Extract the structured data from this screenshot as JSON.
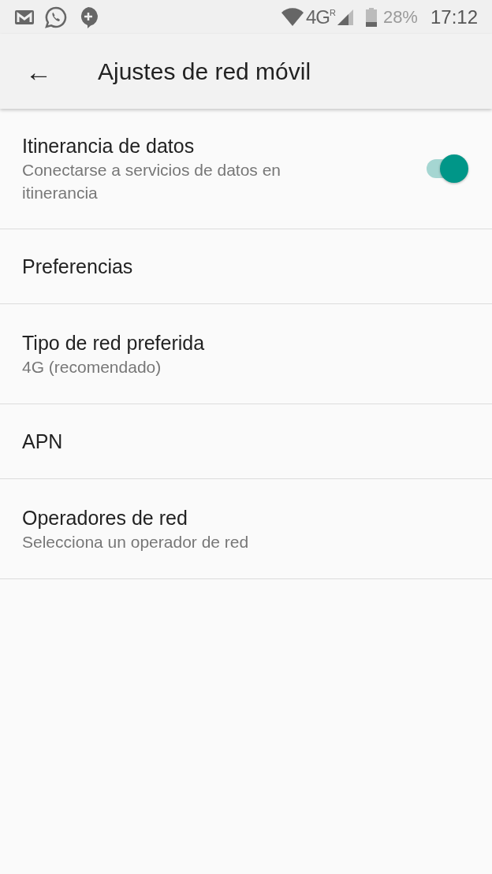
{
  "status_bar": {
    "network": "4G",
    "roaming_mark": "R",
    "battery_percent": "28%",
    "time": "17:12"
  },
  "toolbar": {
    "back": "←",
    "title": "Ajustes de red móvil"
  },
  "settings": [
    {
      "kind": "switch",
      "title": "Itinerancia de datos",
      "summary": "Conectarse a servicios de datos en itinerancia",
      "on": true
    },
    {
      "kind": "plain",
      "title": "Preferencias"
    },
    {
      "kind": "plain",
      "title": "Tipo de red preferida",
      "summary": "4G (recomendado)"
    },
    {
      "kind": "plain",
      "title": "APN"
    },
    {
      "kind": "plain",
      "title": "Operadores de red",
      "summary": "Selecciona un operador de red"
    }
  ]
}
